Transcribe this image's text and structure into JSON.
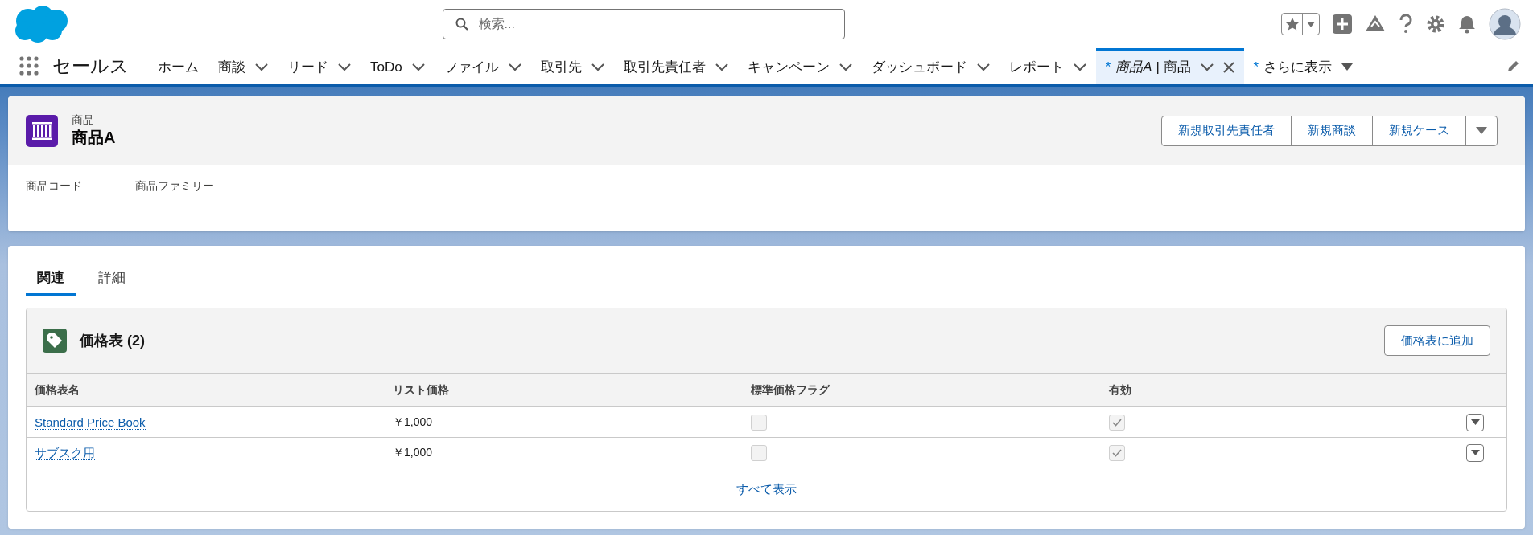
{
  "search": {
    "placeholder": "検索..."
  },
  "app_name": "セールス",
  "nav": [
    {
      "label": "ホーム",
      "kind": "plain",
      "selected": false
    },
    {
      "label": "商談",
      "kind": "menu",
      "selected": false
    },
    {
      "label": "リード",
      "kind": "menu",
      "selected": false
    },
    {
      "label": "ToDo",
      "kind": "menu",
      "selected": false
    },
    {
      "label": "ファイル",
      "kind": "menu",
      "selected": false
    },
    {
      "label": "取引先",
      "kind": "menu",
      "selected": false
    },
    {
      "label": "取引先責任者",
      "kind": "menu",
      "selected": false
    },
    {
      "label": "キャンペーン",
      "kind": "menu",
      "selected": false
    },
    {
      "label": "ダッシュボード",
      "kind": "menu",
      "selected": false
    },
    {
      "label": "レポート",
      "kind": "menu",
      "selected": false
    },
    {
      "label": "*商品A* | 商品",
      "marker": "*",
      "kind": "closable",
      "selected": true
    },
    {
      "label": "さらに表示",
      "marker": "*",
      "kind": "more",
      "selected": false
    }
  ],
  "record": {
    "object": "商品",
    "title": "商品A",
    "actions": [
      "新規取引先責任者",
      "新規商談",
      "新規ケース"
    ],
    "fields": [
      "商品コード",
      "商品ファミリー"
    ]
  },
  "tabs": [
    {
      "label": "関連",
      "selected": true
    },
    {
      "label": "詳細",
      "selected": false
    }
  ],
  "related_list": {
    "title": "価格表 (2)",
    "button": "価格表に追加",
    "columns": [
      "価格表名",
      "リスト価格",
      "標準価格フラグ",
      "有効"
    ],
    "rows": [
      {
        "name": "Standard Price Book",
        "price": "￥1,000",
        "standard": false,
        "active": true
      },
      {
        "name": "サブスク用",
        "price": "￥1,000",
        "standard": false,
        "active": true
      }
    ],
    "footer_link": "すべて表示"
  }
}
